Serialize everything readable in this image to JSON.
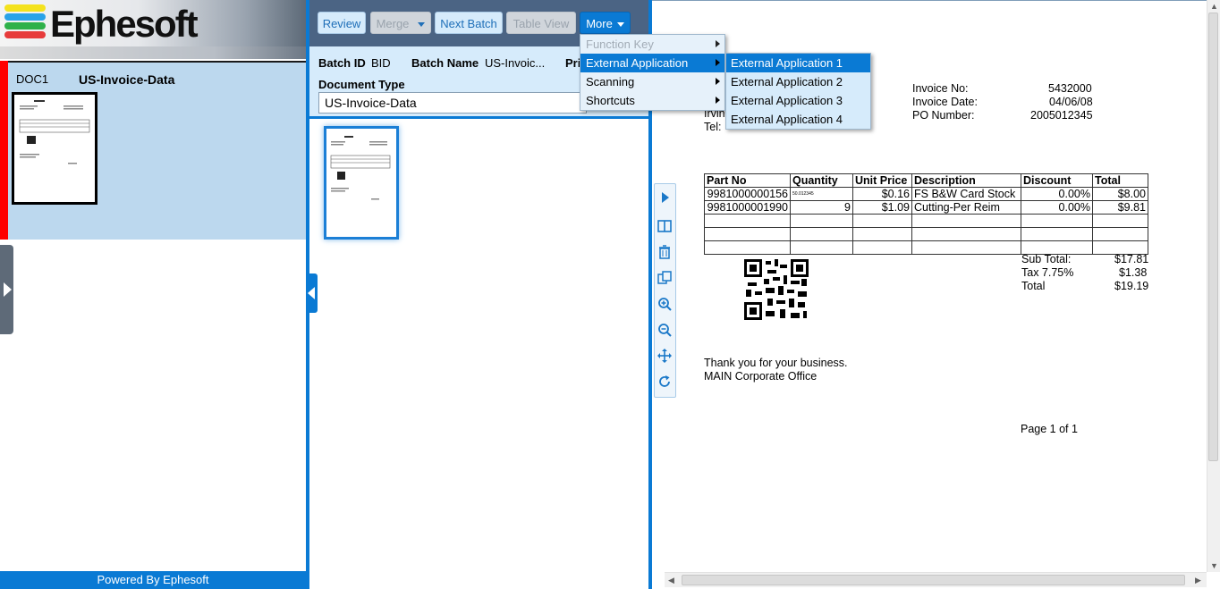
{
  "app": {
    "logo_text": "Ephesoft",
    "powered_by": "Powered By Ephesoft"
  },
  "document_list": [
    {
      "id": "DOC1",
      "name": "US-Invoice-Data"
    }
  ],
  "toolbar": {
    "review": "Review",
    "merge": "Merge",
    "next_batch": "Next Batch",
    "table_view": "Table View",
    "more": "More"
  },
  "batch": {
    "id_label": "Batch ID",
    "id_value": "BID",
    "name_label": "Batch Name",
    "name_value": "US-Invoic...",
    "priority_label": "Pri",
    "document_type_label": "Document Type",
    "document_type_value": "US-Invoice-Data"
  },
  "more_menu": {
    "items": [
      {
        "label": "Function Key",
        "disabled": true,
        "submenu": true
      },
      {
        "label": "External Application",
        "selected": true,
        "submenu": true
      },
      {
        "label": "Scanning",
        "submenu": true
      },
      {
        "label": "Shortcuts",
        "submenu": true
      }
    ],
    "submenu": [
      {
        "label": "External Application 1",
        "selected": true
      },
      {
        "label": "External Application 2"
      },
      {
        "label": "External Application 3"
      },
      {
        "label": "External Application 4"
      }
    ]
  },
  "viewer_tools": [
    "play-icon",
    "split-view-icon",
    "delete-icon",
    "copy-icon",
    "zoom-in-icon",
    "zoom-out-icon",
    "move-icon",
    "rotate-icon"
  ],
  "invoice": {
    "partial_left_1": "Irvin",
    "partial_left_2": "Tel:",
    "invoice_no_label": "Invoice No:",
    "invoice_no": "5432000",
    "invoice_date_label": "Invoice Date:",
    "invoice_date": "04/06/08",
    "po_label": "PO Number:",
    "po_number": "2005012345",
    "table_headers": [
      "Part No",
      "Quantity",
      "Unit Price",
      "Description",
      "Discount",
      "Total"
    ],
    "rows": [
      [
        "9981000000156",
        "50.012345",
        "$0.16",
        "FS B&W Card Stock",
        "0.00%",
        "$8.00"
      ],
      [
        "9981000001990",
        "9",
        "$1.09",
        "Cutting-Per Reim",
        "0.00%",
        "$9.81"
      ]
    ],
    "sub_total_label": "Sub Total:",
    "sub_total": "$17.81",
    "tax_label": "Tax 7.75%",
    "tax": "$1.38",
    "total_label": "Total",
    "total": "$19.19",
    "thanks": "Thank you for your business.",
    "office": "MAIN Corporate Office",
    "page": "Page 1 of 1"
  },
  "colors": {
    "accent": "#0a7ad4",
    "toolbar_bg": "#4b6484",
    "doc_panel_bg": "#bcd8ee",
    "doc_marker": "#ff0000"
  }
}
